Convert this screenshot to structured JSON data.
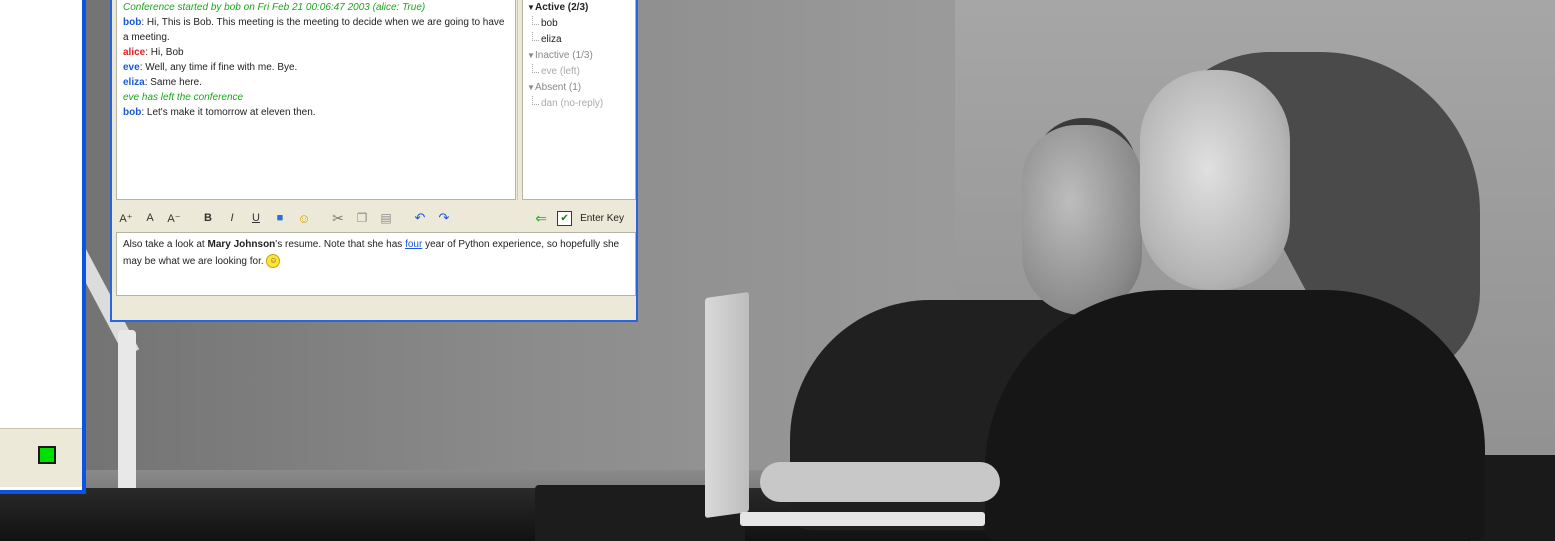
{
  "chat": {
    "log": {
      "system_start": "Conference started by bob on Fri Feb 21 00:06:47 2003 (alice: True)",
      "lines": [
        {
          "user": "bob",
          "text": ": Hi, This is Bob. This meeting is the meeting to decide when we are going to have a meeting."
        },
        {
          "user": "alice",
          "text": ": Hi, Bob"
        },
        {
          "user": "eve",
          "text": ": Well, any time if fine with me. Bye."
        },
        {
          "user": "eliza",
          "text": ": Same here."
        }
      ],
      "system_left": "eve has left the conference",
      "last_line": {
        "user": "bob",
        "text": ": Let's make it tomorrow at eleven then."
      }
    },
    "roster": {
      "active_label": "Active (2/3)",
      "active_members": [
        "bob",
        "eliza"
      ],
      "inactive_label": "Inactive (1/3)",
      "inactive_members": [
        "eve (left)"
      ],
      "absent_label": "Absent (1)",
      "absent_members": [
        "dan (no-reply)"
      ]
    },
    "toolbar": {
      "font_grow": "A⁺",
      "font_reset": "A",
      "font_shrink": "A⁻",
      "bold": "B",
      "italic": "I",
      "underline": "U",
      "enter_key_label": "Enter Key"
    },
    "compose": {
      "part1": "Also take a look at ",
      "name": "Mary Johnson",
      "part2": "'s resume. Note that she has ",
      "link": "four",
      "part3": " year of Python experience, so hopefully she may be what we are looking for. "
    }
  },
  "colors": {
    "accent_blue": "#2a63e6",
    "status_green": "#00e000",
    "system_msg": "#1ca51c",
    "user_blue": "#1b58d6",
    "user_red": "#e42020"
  },
  "icons": [
    "font-grow-icon",
    "font-reset-icon",
    "font-shrink-icon",
    "bold-icon",
    "italic-icon",
    "underline-icon",
    "color-icon",
    "emoticon-icon",
    "cut-icon",
    "copy-icon",
    "paste-icon",
    "undo-icon",
    "redo-icon",
    "send-arrow-icon",
    "checkbox-icon"
  ]
}
